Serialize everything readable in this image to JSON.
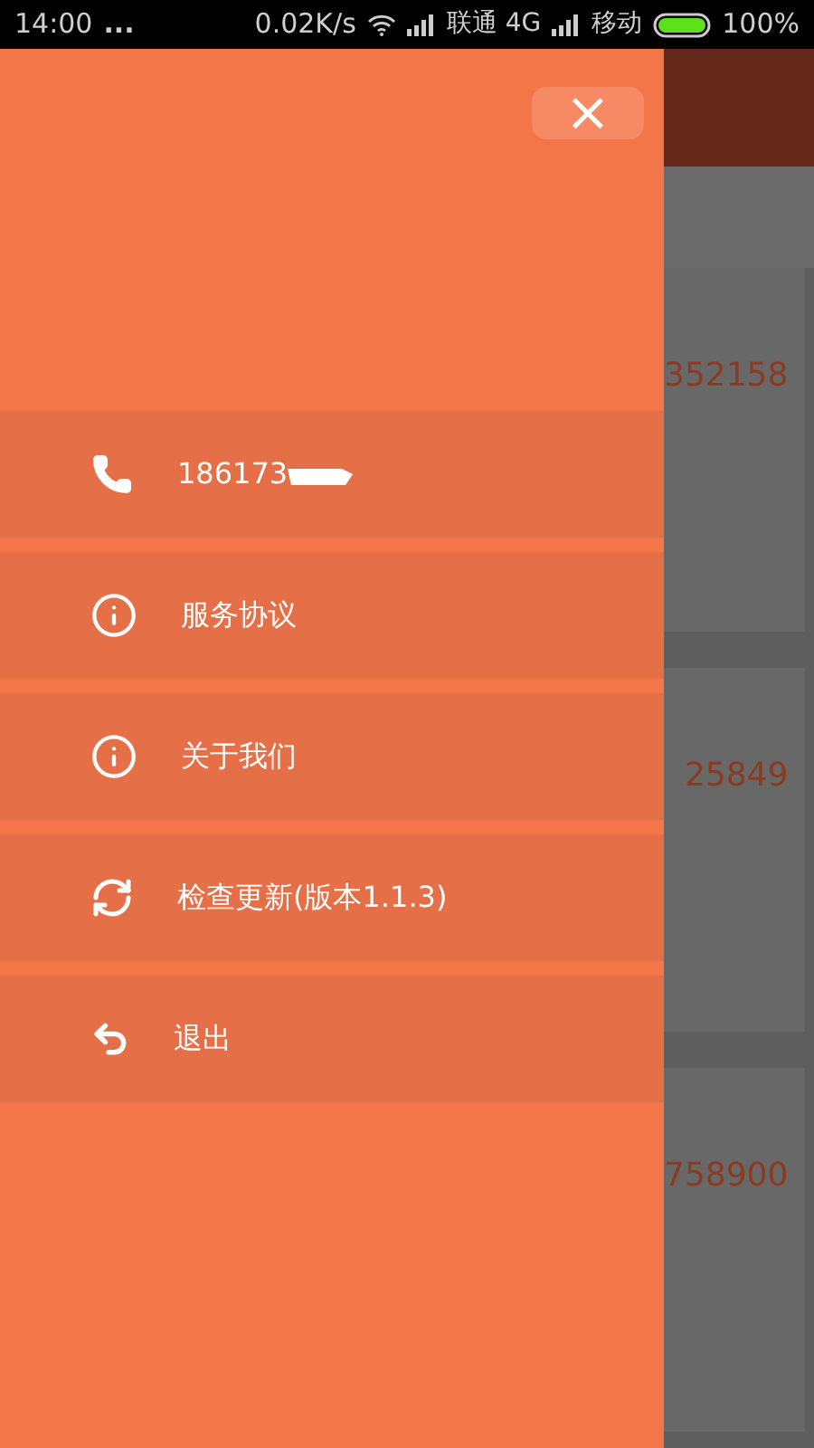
{
  "status_bar": {
    "time": "14:00",
    "more": "...",
    "speed": "0.02K/s",
    "carrier_1": "联通 4G",
    "carrier_2": "移动",
    "battery": "100%"
  },
  "drawer": {
    "close": "×",
    "items": [
      {
        "kind": "phone",
        "label": "186173",
        "redacted": true
      },
      {
        "kind": "info",
        "label": "服务协议",
        "redacted": false
      },
      {
        "kind": "info",
        "label": "关于我们",
        "redacted": false
      },
      {
        "kind": "refresh",
        "label": "检查更新(版本1.1.3)",
        "redacted": false
      },
      {
        "kind": "logout",
        "label": "退出",
        "redacted": false
      }
    ]
  },
  "orders": [
    {
      "phone": "352158"
    },
    {
      "phone": "25849"
    },
    {
      "phone": "758900"
    }
  ]
}
